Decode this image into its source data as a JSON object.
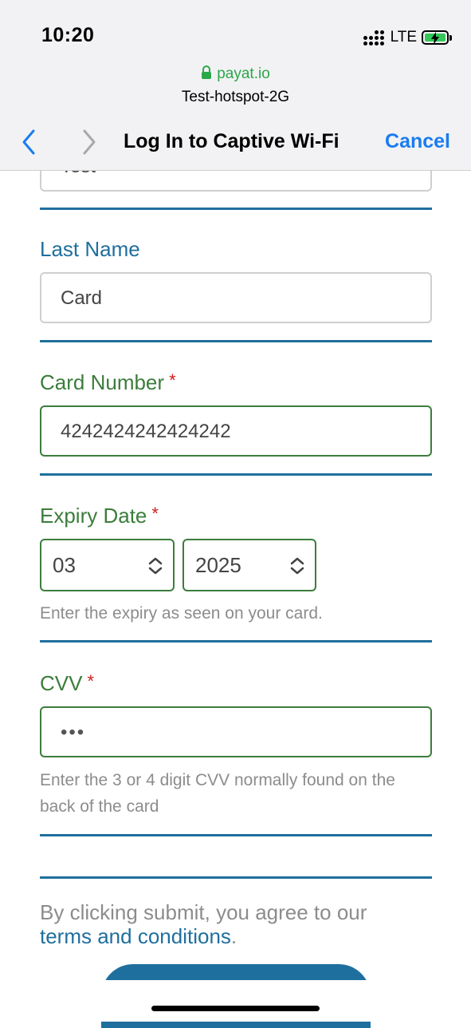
{
  "status_bar": {
    "time": "10:20",
    "network": "LTE",
    "battery_icon": "battery-charging-icon"
  },
  "browser": {
    "domain": "payat.io",
    "ssid": "Test-hotspot-2G",
    "title": "Log In to Captive Wi-Fi",
    "cancel_label": "Cancel"
  },
  "form": {
    "first_name_partial": "Test",
    "last_name": {
      "label": "Last Name",
      "value": "Card"
    },
    "card_number": {
      "label": "Card Number",
      "required_mark": "*",
      "value": "4242424242424242"
    },
    "expiry": {
      "label": "Expiry Date",
      "required_mark": "*",
      "month": "03",
      "year": "2025",
      "help": "Enter the expiry as seen on your card."
    },
    "cvv": {
      "label": "CVV",
      "required_mark": "*",
      "value_masked": "•••",
      "help": "Enter the 3 or 4 digit CVV normally found on the back of the card"
    },
    "agreement": {
      "prefix": "By clicking submit, you agree to our",
      "link": "terms and conditions",
      "suffix": "."
    }
  },
  "colors": {
    "accent_blue": "#1f6f9e",
    "valid_green": "#3c7d3c",
    "required_red": "#d11d1d",
    "ios_link_blue": "#1a7cf0"
  }
}
